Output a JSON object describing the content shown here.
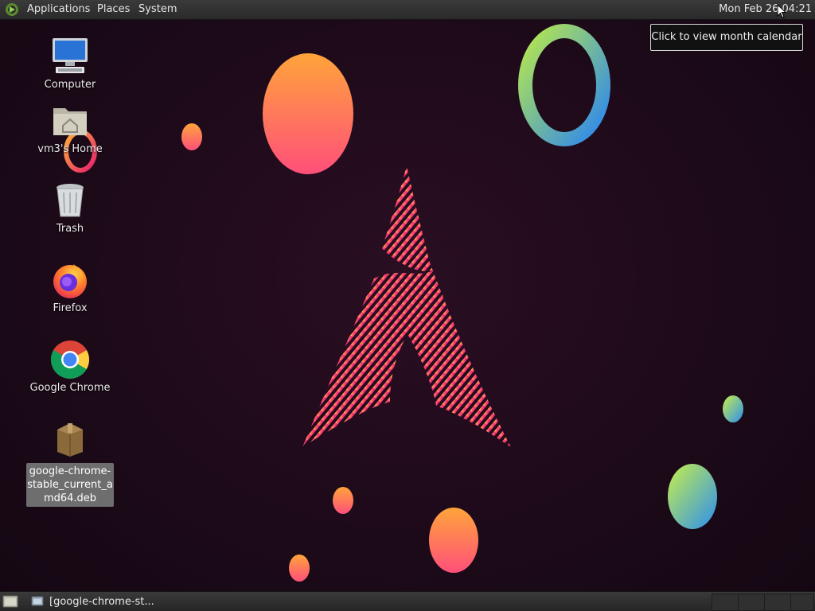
{
  "top_panel": {
    "menus": [
      "Applications",
      "Places",
      "System"
    ],
    "clock": "Mon Feb 26 04:21",
    "tooltip": "Click to view month calendar"
  },
  "desktop_icons": [
    {
      "label": "Computer",
      "icon": "computer-icon"
    },
    {
      "label": "vm3's Home",
      "icon": "home-folder-icon"
    },
    {
      "label": "Trash",
      "icon": "trash-icon"
    },
    {
      "label": "Firefox",
      "icon": "firefox-icon"
    },
    {
      "label": "Google Chrome",
      "icon": "chrome-icon"
    },
    {
      "label": "google-chrome-stable_current_amd64.deb",
      "icon": "package-icon",
      "selected": true
    }
  ],
  "bottom_panel": {
    "task_label": "[google-chrome-st..."
  },
  "colors": {
    "background": "#1d0a19",
    "panel": "#2f2f2f",
    "accent_pink": "#e91e7a",
    "accent_orange": "#ff9a2e"
  }
}
